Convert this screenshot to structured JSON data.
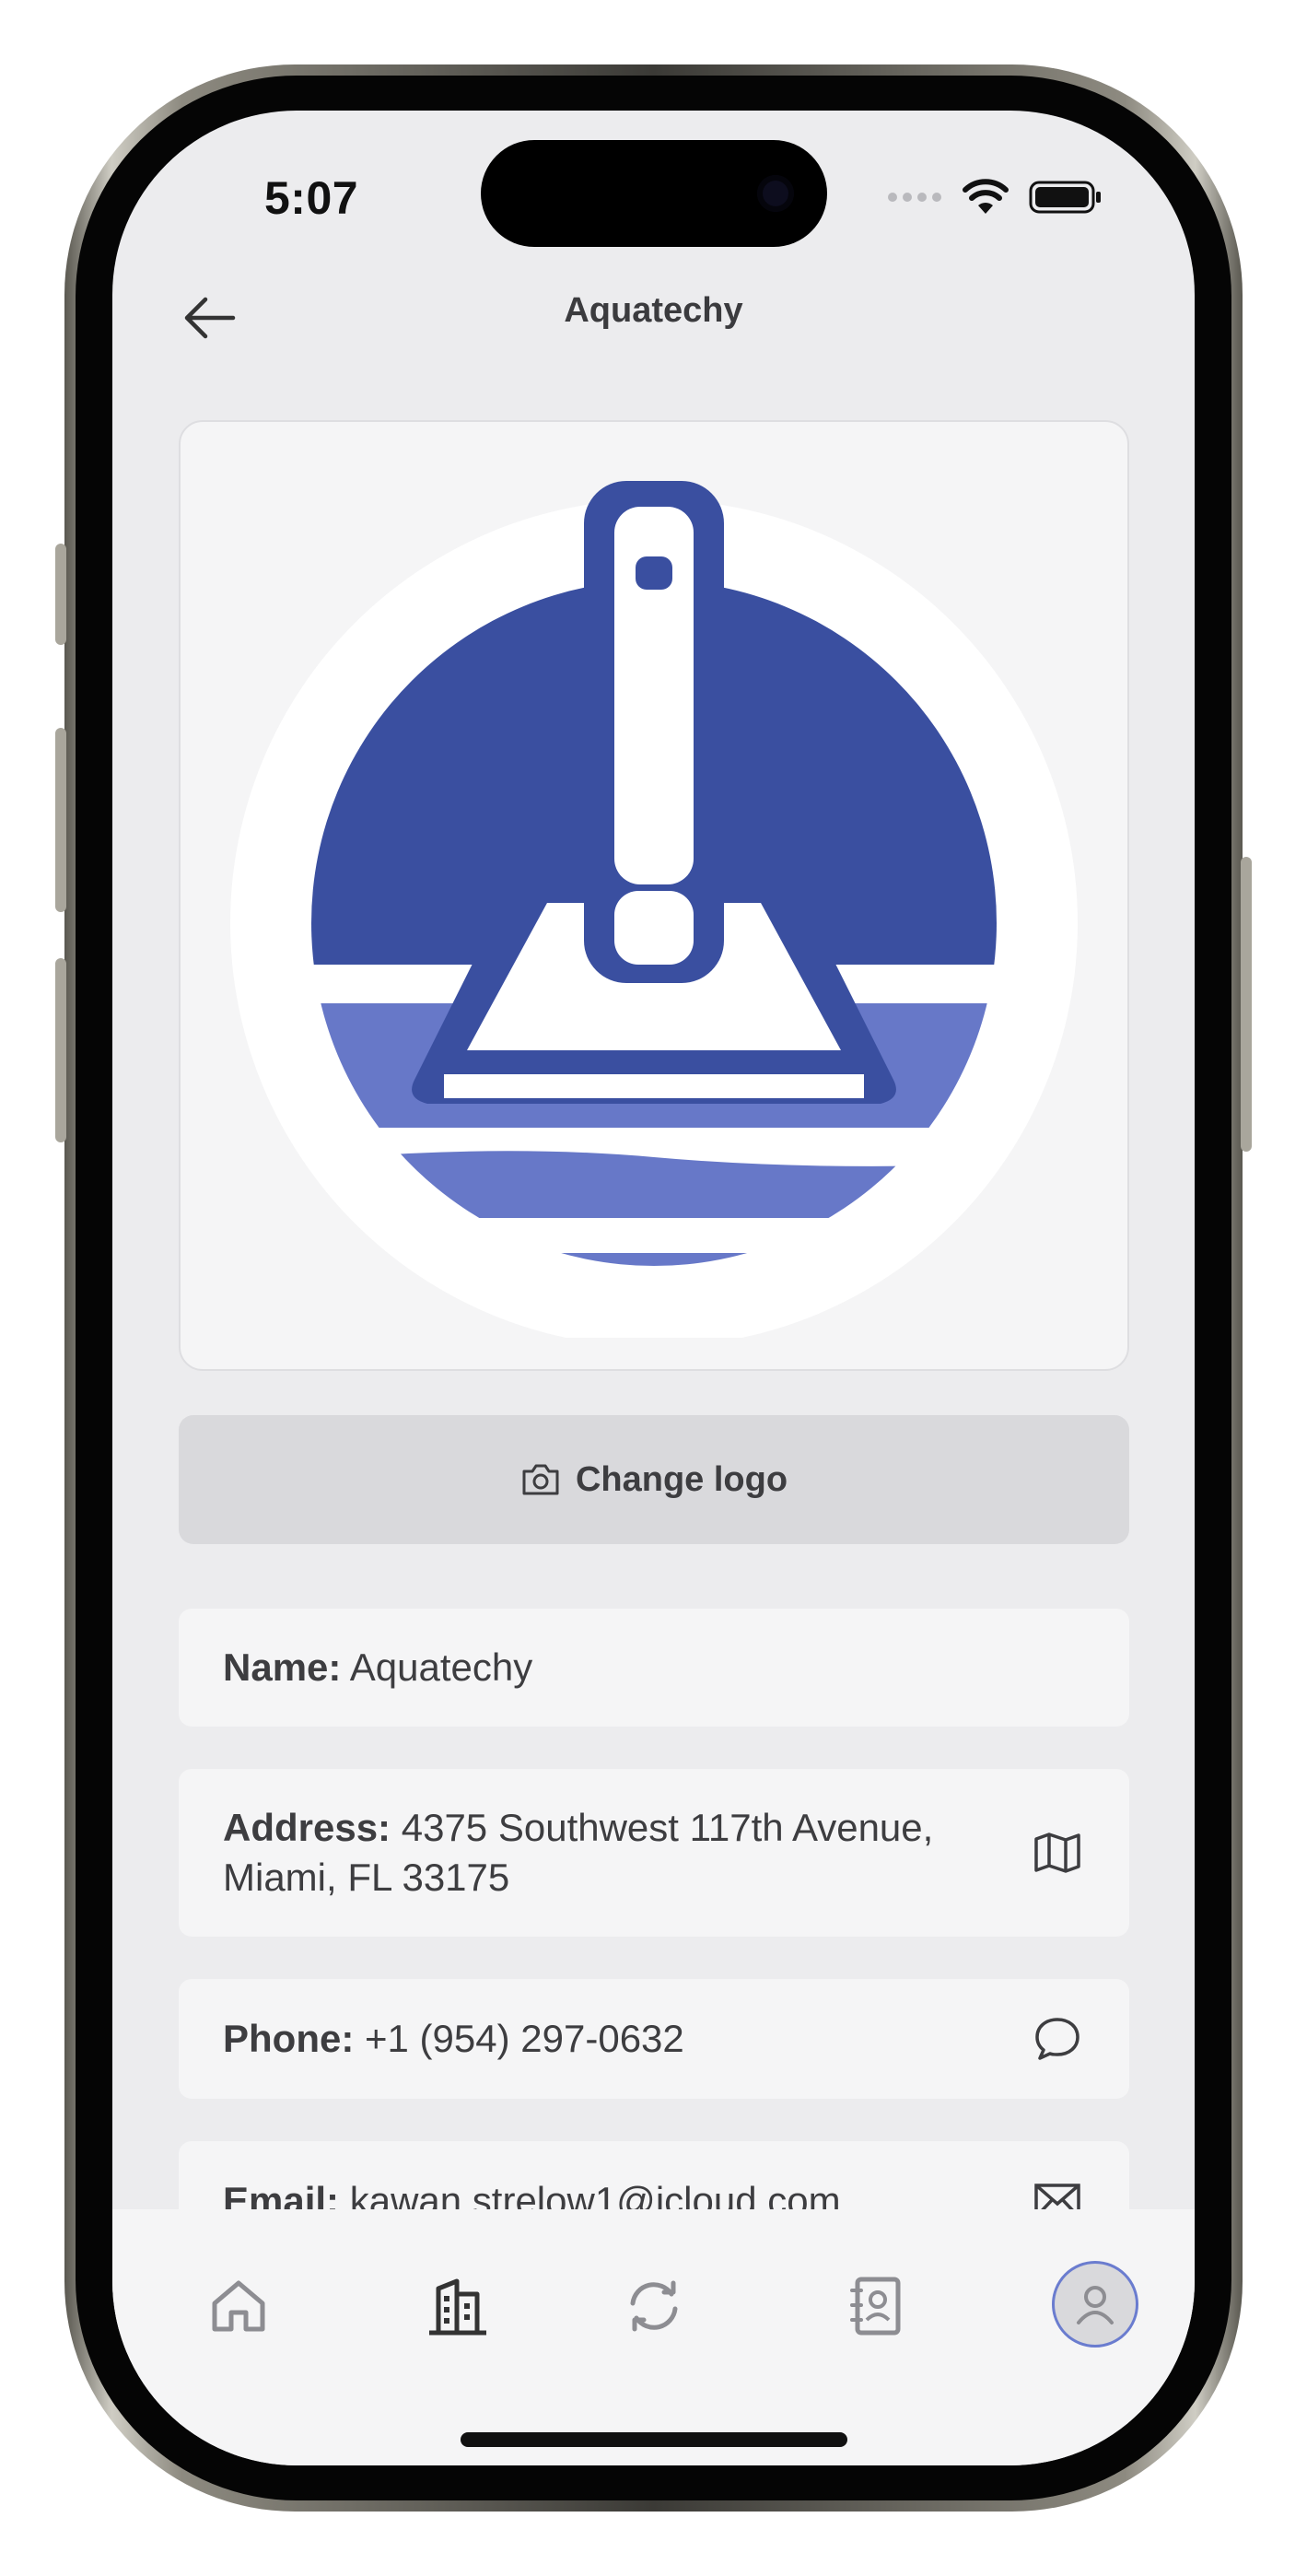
{
  "status_bar": {
    "time": "5:07"
  },
  "header": {
    "title": "Aquatechy"
  },
  "logo": {
    "primary_color": "#3a4fa0",
    "secondary_color": "#6778c8"
  },
  "change_logo": {
    "label": "Change logo"
  },
  "info": {
    "name_label": "Name:",
    "name_value": "Aquatechy",
    "address_label": "Address:",
    "address_value": "4375 Southwest 117th Avenue, Miami, FL 33175",
    "phone_label": "Phone:",
    "phone_value": "+1 (954) 297-0632",
    "email_label": "Email:",
    "email_value": "kawan.strelow1@icloud.com"
  },
  "tabs": [
    {
      "icon": "home-icon",
      "active": false
    },
    {
      "icon": "building-icon",
      "active": true
    },
    {
      "icon": "refresh-icon",
      "active": false
    },
    {
      "icon": "contacts-icon",
      "active": false
    },
    {
      "icon": "profile-avatar",
      "active": false
    }
  ]
}
